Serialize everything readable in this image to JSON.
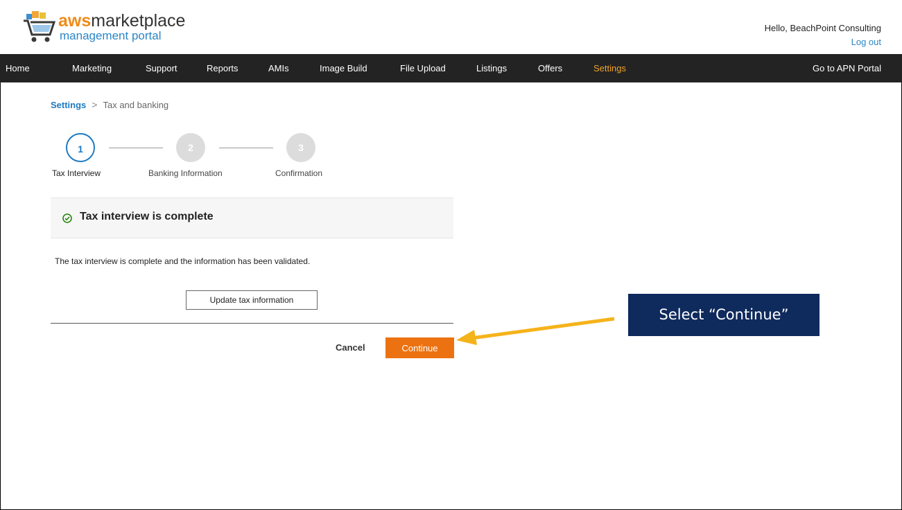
{
  "header": {
    "logo_aws": "aws",
    "logo_marketplace": "marketplace",
    "logo_subtitle": "management portal",
    "greeting": "Hello, BeachPoint Consulting",
    "logout": "Log out"
  },
  "nav": {
    "items": [
      "Home",
      "Marketing",
      "Support",
      "Reports",
      "AMIs",
      "Image Build",
      "File Upload",
      "Listings",
      "Offers",
      "Settings"
    ],
    "active": "Settings",
    "right_link": "Go to APN Portal"
  },
  "breadcrumb": {
    "parent": "Settings",
    "separator": ">",
    "current": "Tax and banking"
  },
  "stepper": {
    "steps": [
      {
        "number": "1",
        "label": "Tax Interview",
        "state": "active"
      },
      {
        "number": "2",
        "label": "Banking Information",
        "state": "inactive"
      },
      {
        "number": "3",
        "label": "Confirmation",
        "state": "inactive"
      }
    ]
  },
  "card": {
    "title": "Tax interview is complete",
    "body": "The tax interview is complete and the information has been validated.",
    "update_button": "Update tax information"
  },
  "actions": {
    "cancel": "Cancel",
    "continue": "Continue"
  },
  "annotation": {
    "callout_text": "Select “Continue”"
  },
  "colors": {
    "nav_bg": "#232323",
    "nav_active": "#f0a32b",
    "link_blue": "#1f7ac1",
    "continue_orange": "#ec7211",
    "callout_bg": "#0f2a5c",
    "arrow_yellow": "#f5b31b",
    "check_green": "#1d8102"
  },
  "icons": {
    "logo": "shopping-cart-icon",
    "status": "check-circle-icon",
    "breadcrumb_separator": "chevron-right-icon",
    "annotation": "arrow-left-icon"
  }
}
